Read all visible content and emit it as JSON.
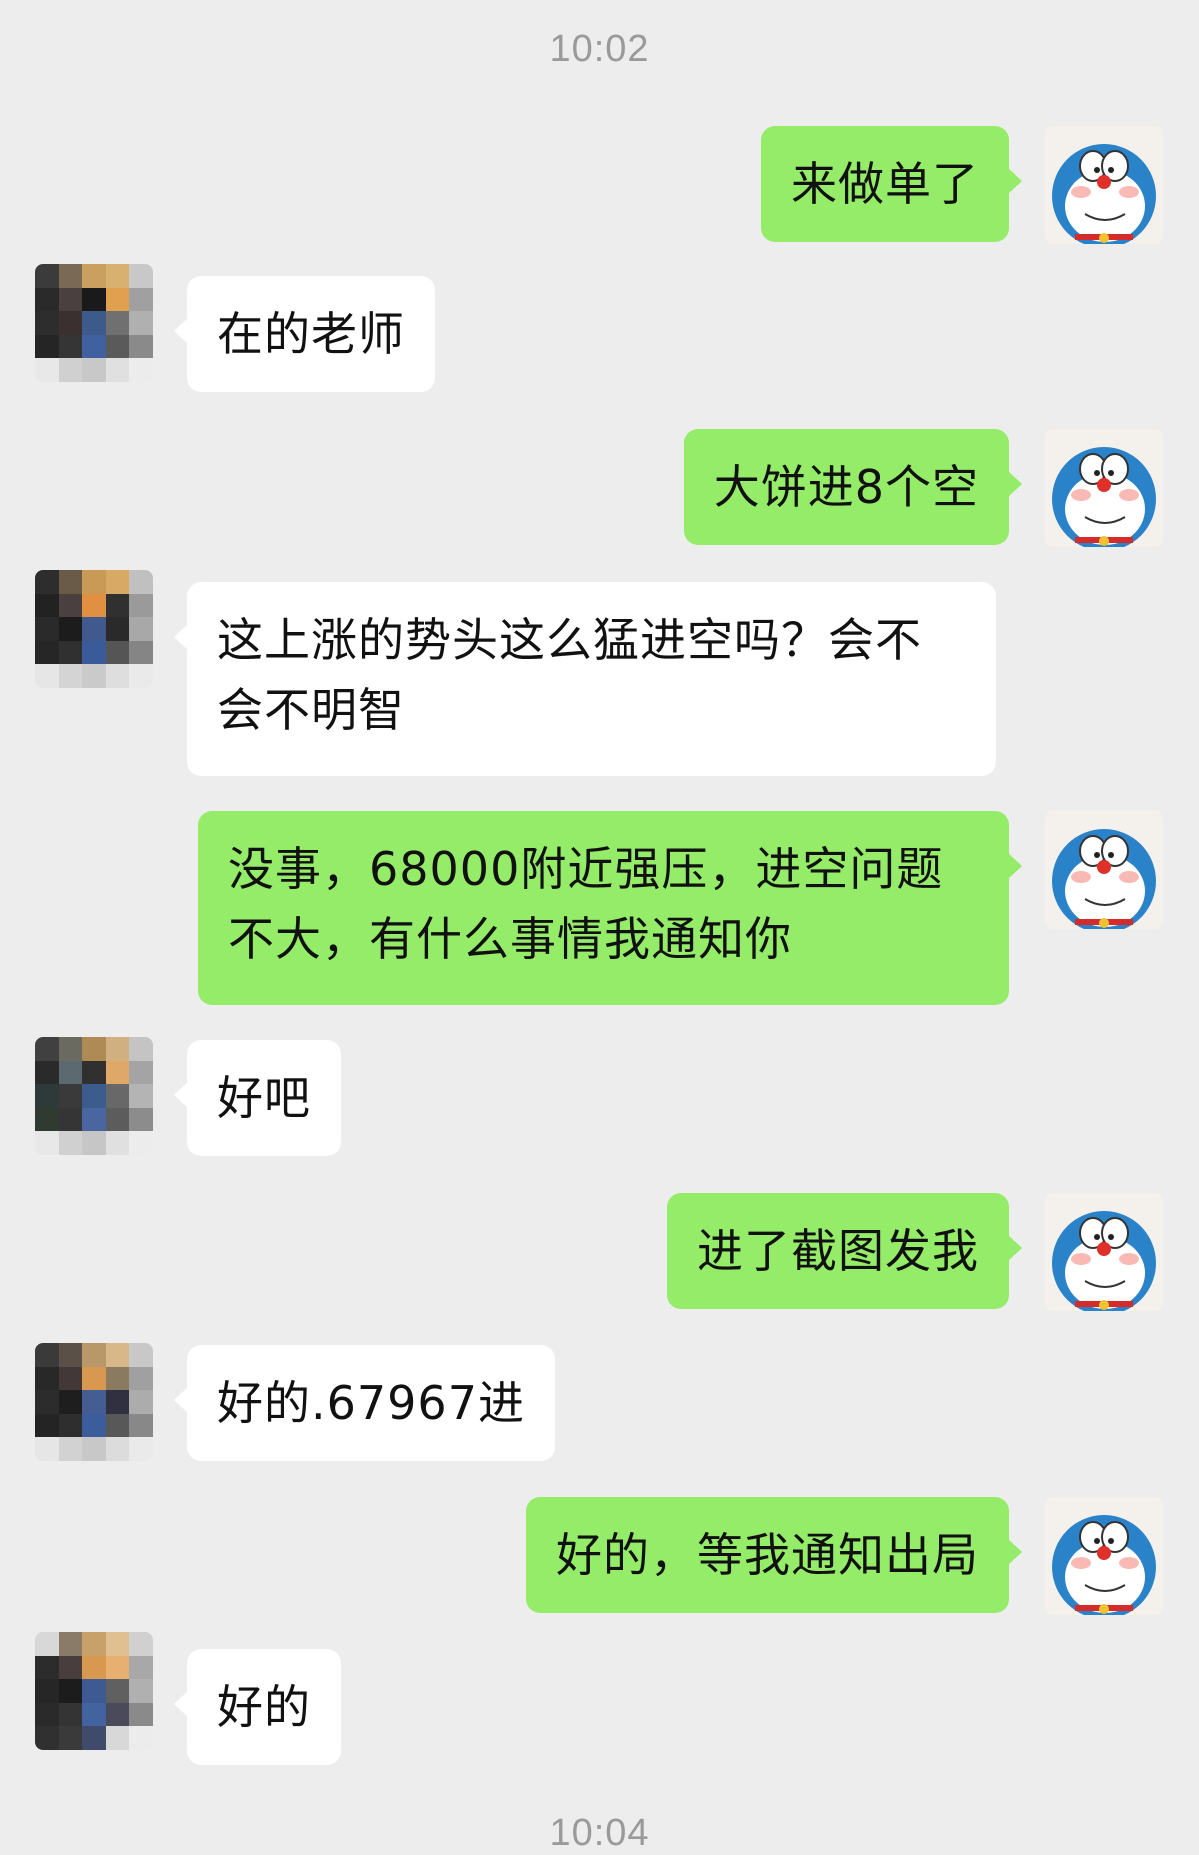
{
  "chat": {
    "timestamp_top": "10:02",
    "timestamp_bottom": "10:04",
    "messages": [
      {
        "side": "out",
        "text": "来做单了"
      },
      {
        "side": "in",
        "text": "在的老师"
      },
      {
        "side": "out",
        "text": "大饼进8个空"
      },
      {
        "side": "in",
        "text": "这上涨的势头这么猛进空吗？会不会不明智"
      },
      {
        "side": "out",
        "text": "没事，68000附近强压，进空问题不大，有什么事情我通知你"
      },
      {
        "side": "in",
        "text": "好吧"
      },
      {
        "side": "out",
        "text": "进了截图发我"
      },
      {
        "side": "in",
        "text": "好的.67967进"
      },
      {
        "side": "out",
        "text": "好的，等我通知出局"
      },
      {
        "side": "in",
        "text": "好的"
      }
    ]
  },
  "colors": {
    "background": "#ededed",
    "outgoing_bubble": "#95ec69",
    "incoming_bubble": "#ffffff",
    "timestamp_text": "#9a9a9a"
  },
  "icons": {
    "self_avatar": "doraemon-avatar-icon",
    "contact_avatar": "pixelated-avatar-icon"
  }
}
